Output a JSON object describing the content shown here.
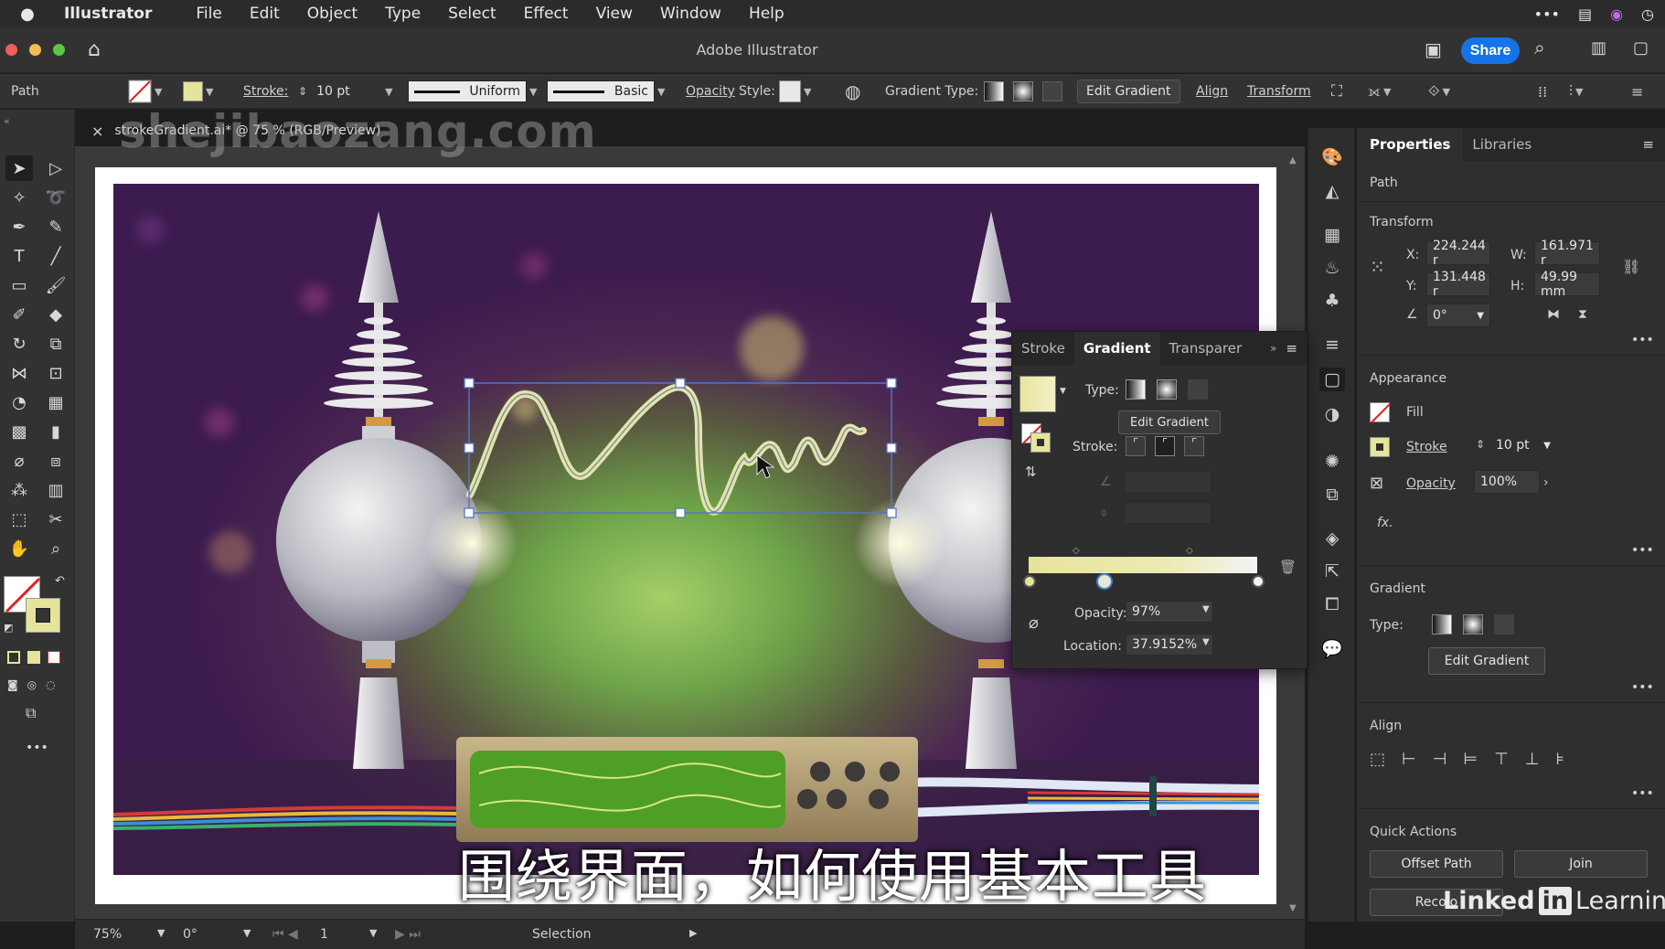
{
  "menubar": {
    "app": "Illustrator",
    "items": [
      "File",
      "Edit",
      "Object",
      "Type",
      "Select",
      "Effect",
      "View",
      "Window",
      "Help"
    ]
  },
  "window": {
    "title": "Adobe Illustrator",
    "share": "Share"
  },
  "control": {
    "selection_type": "Path",
    "stroke_label": "Stroke:",
    "stroke_value": "10 pt",
    "profile": "Uniform",
    "brush": "Basic",
    "opacity_label": "Opacity",
    "style_label": "Style:",
    "gradient_type_label": "Gradient Type:",
    "edit_gradient": "Edit Gradient",
    "align": "Align",
    "transform": "Transform"
  },
  "document": {
    "tab": "strokeGradient.ai* @ 75 % (RGB/Preview)",
    "close": "×"
  },
  "status": {
    "zoom": "75%",
    "rotation": "0°",
    "artboard": "1",
    "tool": "Selection"
  },
  "gradient_panel": {
    "tabs": [
      "Stroke",
      "Gradient",
      "Transparer"
    ],
    "type_label": "Type:",
    "edit_gradient": "Edit Gradient",
    "stroke_label": "Stroke:",
    "opacity_label": "Opacity:",
    "opacity_value": "97%",
    "location_label": "Location:",
    "location_value": "37.9152%"
  },
  "properties": {
    "tabs": [
      "Properties",
      "Libraries"
    ],
    "selection": "Path",
    "transform": {
      "title": "Transform",
      "x_label": "X:",
      "x": "224.244 r",
      "y_label": "Y:",
      "y": "131.448 r",
      "w_label": "W:",
      "w": "161.971 r",
      "h_label": "H:",
      "h": "49.99 mm",
      "angle": "0°"
    },
    "appearance": {
      "title": "Appearance",
      "fill": "Fill",
      "stroke": "Stroke",
      "stroke_value": "10 pt",
      "opacity": "Opacity",
      "opacity_value": "100%",
      "fx": "fx."
    },
    "gradient": {
      "title": "Gradient",
      "type_label": "Type:",
      "edit": "Edit Gradient"
    },
    "align": {
      "title": "Align"
    },
    "quick_actions": {
      "title": "Quick Actions",
      "offset_path": "Offset Path",
      "join": "Join",
      "recolor": "Recolo"
    }
  },
  "overlay": {
    "subtitle": "围绕界面，如何使用基本工具",
    "watermark": "shejibaozang.com",
    "logo_text1": "Linked",
    "logo_in": "in",
    "logo_text2": "Learning"
  },
  "colors": {
    "accent": "#1473e6",
    "gradient_light": "#e8e4a0",
    "path_stroke": "#cfd08a"
  }
}
